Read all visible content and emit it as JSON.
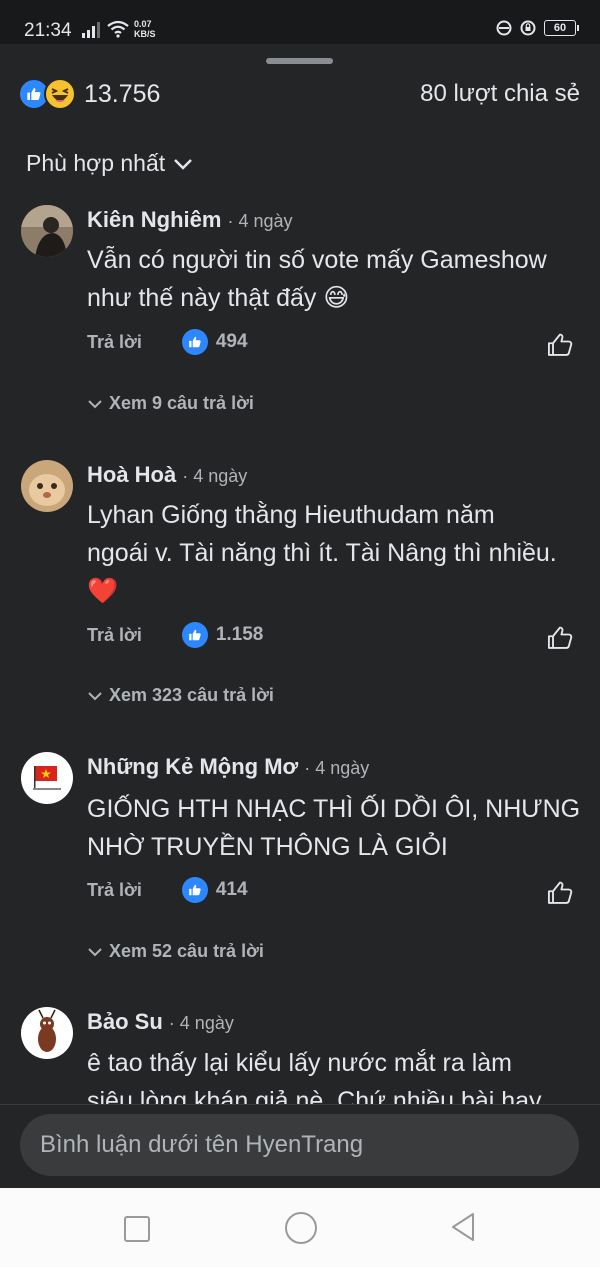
{
  "status_bar": {
    "time": "21:34",
    "net_speed": "0.07",
    "net_unit": "KB/S",
    "battery": "60"
  },
  "summary": {
    "reaction_count": "13.756",
    "share_text": "80 lượt chia sẻ"
  },
  "sort": {
    "label": "Phù hợp nhất"
  },
  "comments": [
    {
      "name": "Kiên Nghiêm",
      "time": "· 4 ngày",
      "text_lines": [
        "Vẫn có người tin số vote mấy Gameshow",
        "như thế này thật đấy 😅"
      ],
      "reply_label": "Trả lời",
      "likes": "494",
      "view_replies": "Xem 9 câu trả lời"
    },
    {
      "name": "Hoà Hoà",
      "time": "· 4 ngày",
      "text_lines": [
        "Lyhan Giống thằng Hieuthudam năm",
        "ngoái v. Tài năng thì ít. Tài Nâng thì nhiều.",
        "❤️"
      ],
      "reply_label": "Trả lời",
      "likes": "1.158",
      "view_replies": "Xem 323 câu trả lời"
    },
    {
      "name": "Những Kẻ Mộng Mơ",
      "time": "· 4 ngày",
      "text_lines": [
        "GIỐNG HTH NHẠC THÌ ỐI DỒI ÔI, NHƯNG",
        "NHỜ TRUYỀN THÔNG LÀ GIỎI"
      ],
      "reply_label": "Trả lời",
      "likes": "414",
      "view_replies": "Xem 52 câu trả lời"
    },
    {
      "name": "Bảo Su",
      "time": "· 4 ngày",
      "text_lines": [
        "ê tao thấy lại kiểu lấy nước mắt ra làm",
        "siêu lòng khán giả nè. Chứ nhiều bài hay"
      ]
    }
  ],
  "composer": {
    "placeholder": "Bình luận dưới tên HyenTrang"
  },
  "colors": {
    "accent": "#2d88ff",
    "background": "#242526",
    "secondary_text": "#b0b3b8"
  }
}
